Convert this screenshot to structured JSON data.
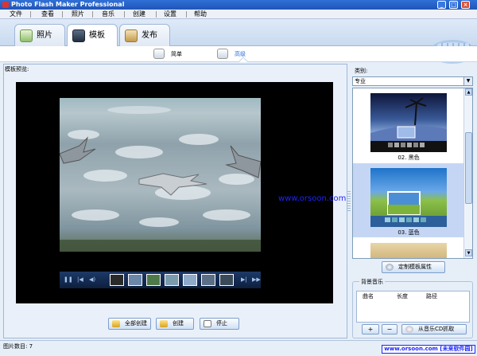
{
  "window": {
    "title": "Photo Flash Maker Professional",
    "controls": [
      "_",
      "□",
      "×"
    ]
  },
  "menu": [
    {
      "label": "文件"
    },
    {
      "label": "查看"
    },
    {
      "label": "照片"
    },
    {
      "label": "音乐"
    },
    {
      "label": "创建"
    },
    {
      "label": "设置"
    },
    {
      "label": "帮助"
    }
  ],
  "tabs": [
    {
      "label": "照片"
    },
    {
      "label": "模板"
    },
    {
      "label": "发布"
    }
  ],
  "subtabs": [
    {
      "label": "简单"
    },
    {
      "label": "高级"
    }
  ],
  "preview": {
    "title": "模板预览:",
    "watermark": "www.orsoon.com"
  },
  "actions": [
    {
      "label": "全部创建"
    },
    {
      "label": "创建"
    },
    {
      "label": "停止"
    }
  ],
  "category": {
    "label": "类别:",
    "selected": "专业"
  },
  "templates": [
    {
      "caption": "02. 黑色"
    },
    {
      "caption": "03. 蓝色"
    }
  ],
  "customize": {
    "label": "定制模板属性"
  },
  "music": {
    "group_title": "背景音乐",
    "columns": [
      "曲名",
      "长度",
      "路径"
    ],
    "add_label": "+",
    "remove_label": "−",
    "cd_label": "从音乐CD抓取"
  },
  "status": {
    "photo_count_label": "图片数目:",
    "photo_count_value": "7",
    "site_badge": "www.orsoon.com [未来软件园]"
  },
  "colors": {
    "title_blue": "#2f6fd6",
    "watermark_blue": "#1b24ff"
  }
}
